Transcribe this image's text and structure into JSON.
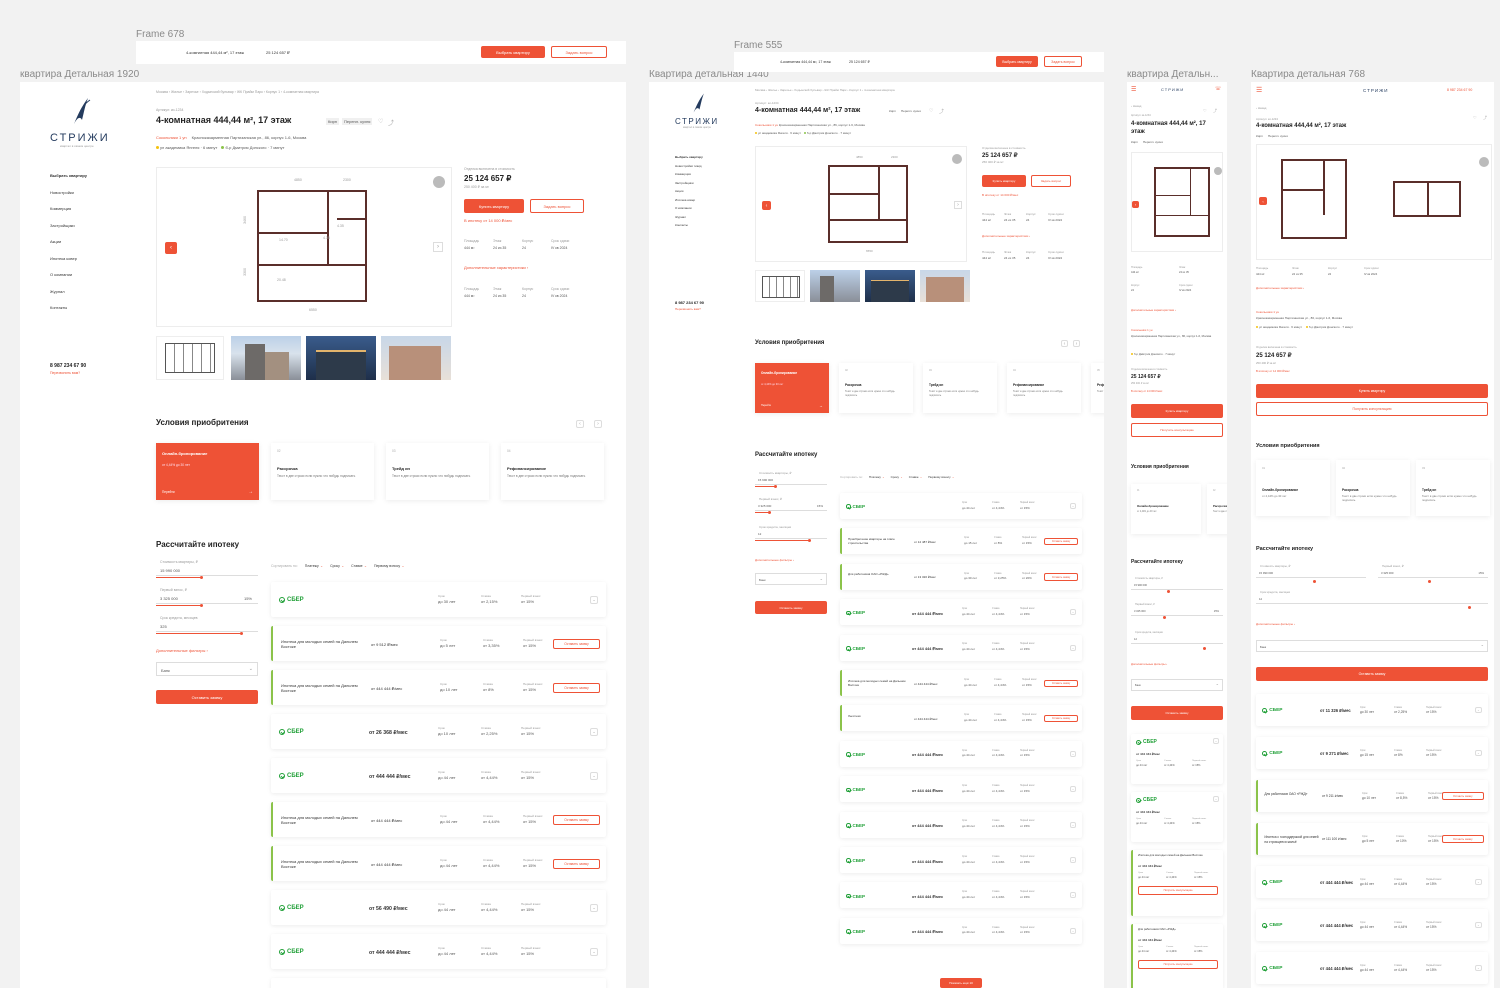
{
  "labels": {
    "frame678": "Frame 678",
    "f1920": "квартира Детальная 1920",
    "frame555": "Frame 555",
    "f1440": "Квартира детальная 1440",
    "fmob": "квартира Детальн...",
    "f768": "Квартира детальная 768"
  },
  "brand": {
    "name": "СТРИЖИ",
    "tagline": "квартал в самом центре",
    "accent": "#ee5236",
    "sber_color": "#21a038"
  },
  "sticky": {
    "title": "4-комнатная 444,44 м², 17 этаж",
    "price": "25 124 657 ₽",
    "buy": "Выбрать квартиру",
    "ask": "Задать вопрос"
  },
  "breadcrumb": "Москва › Жилье › Заречье › Ходынский бульвар › ЖК Прайм Парк › Корпус 1 › 4-комнатная квартира",
  "apt": {
    "code": "Артикул: ки-1234",
    "title": "4-комнатная 444,44 м², 17 этаж",
    "tag1": "Кирп",
    "tag2": "Перепл. кухня",
    "district": "Сокольники 1 ун",
    "address": "Красноказарменная Партизанская ул., 86, корпус 1-6, Москва",
    "metro1": "ул академика Янгеля",
    "metro1_time": "6 минут",
    "metro2": "б-р Дмитрия Донского",
    "metro2_time": "7 минут",
    "price_note": "Отделка включена в стоимость",
    "price": "25 124 657 ₽",
    "price_m2": "250 400 ₽ за м²",
    "buy": "Купить квартиру",
    "ask": "Задать вопрос",
    "mortgage_note": "В ипотеку от 14 000 ₽/мес",
    "more": "Дополнительные характеристики",
    "specs_head": [
      "Площадь",
      "Этаж",
      "Корпус",
      "Срок сдачи"
    ],
    "specs_val": [
      "444 м²",
      "24 из 35",
      "24",
      "IV кв 2024"
    ],
    "dims": [
      "4850",
      "2300",
      "3460",
      "3300",
      "6550",
      "14.70",
      "20.48",
      "4.35",
      "4.35"
    ]
  },
  "nav": [
    "Выбрать квартиру",
    "Новостройки",
    "Коммерция",
    "Застройщики",
    "Акции",
    "Ипотека ковер",
    "О компании",
    "Журнал",
    "Контакты"
  ],
  "nav_1440": [
    "Выбрать квартиру",
    "Новостройки тикид",
    "Коммерция",
    "Застройщики",
    "Акции",
    "Ипотека ковер",
    "О компании",
    "Журнал",
    "Контакты"
  ],
  "phone": "8 987 234 67 90",
  "callback": "Перезвонить вам?",
  "conditions": {
    "title": "Условия приобритения",
    "items": [
      {
        "num": "01",
        "name": "Онлайн-бронирование",
        "desc": "от 4,44% до 30 лет",
        "link": "Перейти"
      },
      {
        "num": "02",
        "name": "Рассрочка",
        "desc": "Текст в две строки если нужно что нибудь подписать"
      },
      {
        "num": "03",
        "name": "Трейд ин",
        "desc": "Текст в две строки если нужно что нибудь подписать"
      },
      {
        "num": "04",
        "name": "Рефинансирование",
        "desc": "Текст в две строки если нужно что нибудь подписать"
      },
      {
        "num": "05",
        "name": "Рефинан",
        "desc": "Текст в две"
      }
    ]
  },
  "mortgage": {
    "title": "Рассчитайте ипотеку",
    "price_label": "Стоимость квартиры, ₽",
    "price_val": "15 990 000",
    "first_label": "Первый взнос, ₽",
    "first_val": "3 325 000",
    "first_pct": "15%",
    "term_label": "Срок кредита, месяцев",
    "term_val": "325",
    "term_val_s": "12",
    "filters": "Дополнительные фильтры",
    "bank": "Банк",
    "submit": "Оставить заявку",
    "sort": [
      "Сортировать по:",
      "Платежу",
      "Сроку",
      "Ставке",
      "Первому взносу"
    ],
    "sber": "СБЕР",
    "apply": "Оставить заявку",
    "consult": "Получить консультацию",
    "show_more": "Показать ещё 10",
    "col_heads": [
      "Срок",
      "Ставка",
      "Первый взнос"
    ],
    "rows": [
      {
        "type": "sber",
        "pay": "",
        "term": "до 30 лет",
        "rate": "от 2,15%",
        "first": "от 15%"
      },
      {
        "type": "prog",
        "name": "Ипотека для молодых семей на Дальнем Востоке",
        "pay": "от 9 512 ₽/мес",
        "term": "до 5 лет",
        "rate": "от 3,35%",
        "first": "от 15%"
      },
      {
        "type": "prog",
        "name": "Ипотека для молодых семей на Дальнем Востоке",
        "pay": "от 444 444 ₽/мес",
        "term": "до 10 лет",
        "rate": "от 8%",
        "first": "от 15%"
      },
      {
        "type": "sber",
        "pay": "от 26 368 ₽/мес",
        "term": "до 10 лет",
        "rate": "от 2,25%",
        "first": "от 15%"
      },
      {
        "type": "sber",
        "pay": "от 444 444 ₽/мес",
        "term": "до 44 лет",
        "rate": "от 4,44%",
        "first": "от 15%"
      },
      {
        "type": "prog",
        "name": "Ипотека для молодых семей на Дальнем Востоке",
        "pay": "от 444 444 ₽/мес",
        "term": "до 44 лет",
        "rate": "от 4,44%",
        "first": "от 15%"
      },
      {
        "type": "prog",
        "name": "Ипотека для молодых семей на Дальнем Востоке",
        "pay": "от 444 444 ₽/мес",
        "term": "до 44 лет",
        "rate": "от 4,44%",
        "first": "от 15%"
      },
      {
        "type": "sber",
        "pay": "от 56 490 ₽/мес",
        "term": "до 44 лет",
        "rate": "от 4,44%",
        "first": "от 15%"
      },
      {
        "type": "sber",
        "pay": "от 444 444 ₽/мес",
        "term": "до 44 лет",
        "rate": "от 4,44%",
        "first": "от 15%"
      },
      {
        "type": "sber",
        "pay": "от 444 444 ₽/мес",
        "term": "до 44 лет",
        "rate": "от 4,44%",
        "first": "от 15%"
      }
    ],
    "rows_1440": [
      {
        "type": "sber",
        "pay": "",
        "term": "до 44 лет",
        "rate": "от 4,44%",
        "first": "от 15%"
      },
      {
        "type": "prog",
        "name": "Приобретение квартиры на этапе строительства",
        "pay": "от 12 487 ₽/мес",
        "term": "до 15 лет",
        "rate": "от 8%",
        "first": "от 15%"
      },
      {
        "type": "prog",
        "name": "Для работников ОАО «РЖД»",
        "pay": "от 13 320 ₽/мес",
        "term": "до 30 лет",
        "rate": "от 3,25%",
        "first": "от 20%"
      },
      {
        "type": "sber",
        "pay": "от 444 444 ₽/мес",
        "term": "до 44 лет",
        "rate": "от 4,44%",
        "first": "от 15%"
      },
      {
        "type": "sber",
        "pay": "от 444 444 ₽/мес",
        "term": "до 44 лет",
        "rate": "от 4,44%",
        "first": "от 15%"
      },
      {
        "type": "prog",
        "name": "Ипотека для молодых семей на Дальнем Востоке",
        "pay": "от 444 444 ₽/мес",
        "term": "до 44 лет",
        "rate": "от 4,44%",
        "first": "от 15%"
      },
      {
        "type": "prog",
        "name": "Льготная",
        "pay": "от 444 444 ₽/мес",
        "term": "до 44 лет",
        "rate": "от 4,44%",
        "first": "от 15%"
      },
      {
        "type": "sber",
        "pay": "от 444 444 ₽/мес",
        "term": "до 44 лет",
        "rate": "от 4,44%",
        "first": "от 15%"
      },
      {
        "type": "sber",
        "pay": "от 444 444 ₽/мес",
        "term": "до 44 лет",
        "rate": "от 4,44%",
        "first": "от 15%"
      },
      {
        "type": "sber",
        "pay": "от 444 444 ₽/мес",
        "term": "до 44 лет",
        "rate": "от 4,44%",
        "first": "от 15%"
      },
      {
        "type": "sber",
        "pay": "от 444 444 ₽/мес",
        "term": "до 44 лет",
        "rate": "от 4,44%",
        "first": "от 15%"
      },
      {
        "type": "sber",
        "pay": "от 444 444 ₽/мес",
        "term": "до 44 лет",
        "rate": "от 4,44%",
        "first": "от 15%"
      },
      {
        "type": "sber",
        "pay": "от 444 444 ₽/мес",
        "term": "до 44 лет",
        "rate": "от 4,44%",
        "first": "от 15%"
      }
    ],
    "rows_768": [
      {
        "type": "sber",
        "pay": "от 11 326 ₽/мес",
        "term": "до 30 лет",
        "rate": "от 2,25%",
        "first": "от 15%"
      },
      {
        "type": "sber",
        "pay": "от 9 271 ₽/мес",
        "term": "до 15 лет",
        "rate": "от 8%",
        "first": "от 15%"
      },
      {
        "type": "prog",
        "name": "Для работников ОАО «РЖД»",
        "pay": "от 9 211 ₽/мес",
        "term": "до 10 лет",
        "rate": "от 8,5%",
        "first": "от 15%"
      },
      {
        "type": "prog",
        "name": "Ипотека с господдержкой для семей на строящееся жильё",
        "pay": "от 111 100 ₽/мес",
        "term": "до 5 лет",
        "rate": "от 10%",
        "first": "от 15%"
      },
      {
        "type": "sber",
        "pay": "от 444 444 ₽/мес",
        "term": "до 44 лет",
        "rate": "от 4,44%",
        "first": "от 15%"
      },
      {
        "type": "sber",
        "pay": "от 444 444 ₽/мес",
        "term": "до 44 лет",
        "rate": "от 4,44%",
        "first": "от 15%"
      },
      {
        "type": "sber",
        "pay": "от 444 444 ₽/мес",
        "term": "до 44 лет",
        "rate": "от 4,44%",
        "first": "от 15%"
      }
    ],
    "rows_mob": [
      {
        "type": "sber",
        "pay": "от 444 444 ₽/мес",
        "term": "до 44 лет",
        "rate": "от 4,44%",
        "first": "от 15%"
      },
      {
        "type": "sber",
        "pay": "от 444 444 ₽/мес",
        "term": "до 44 лет",
        "rate": "от 4,44%",
        "first": "от 15%"
      },
      {
        "type": "prog",
        "name": "Ипотека для молодых семей на Дальнем Востоке",
        "pay": "от 444 444 ₽/мес",
        "term": "до 44 лет",
        "rate": "от 4,44%",
        "first": "от 15%"
      },
      {
        "type": "prog",
        "name": "Для работников ОАО «РЖД»",
        "pay": "от 444 444 ₽/мес",
        "term": "до 44 лет",
        "rate": "от 4,44%",
        "first": "от 15%"
      }
    ]
  },
  "phone_768": "8 987 234 67 90"
}
